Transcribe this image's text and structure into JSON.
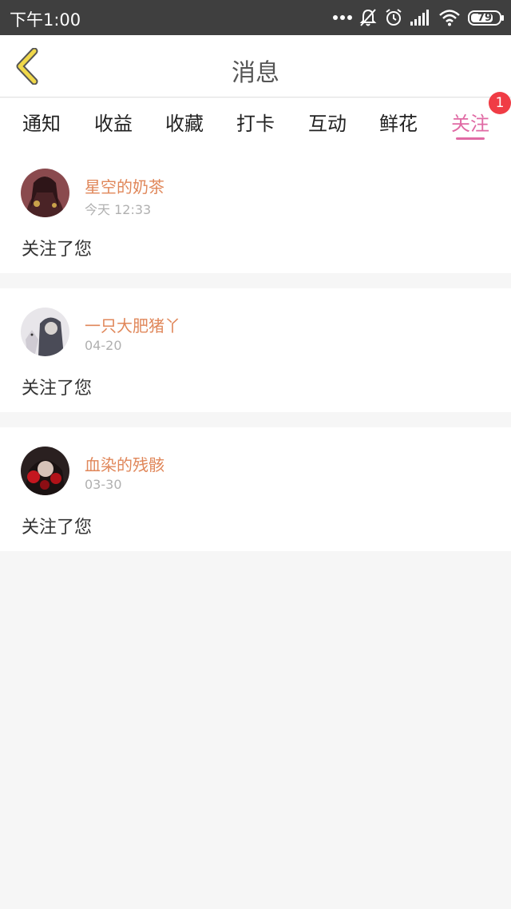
{
  "status_bar": {
    "time": "下午1:00",
    "battery": "79",
    "icons": [
      "more-dots-icon",
      "bell-muted-icon",
      "alarm-icon",
      "signal-icon",
      "wifi-icon",
      "battery-icon"
    ]
  },
  "header": {
    "title": "消息",
    "back_icon": "chevron-left-icon"
  },
  "tabs": [
    {
      "label": "通知"
    },
    {
      "label": "收益"
    },
    {
      "label": "收藏"
    },
    {
      "label": "打卡"
    },
    {
      "label": "互动"
    },
    {
      "label": "鲜花"
    },
    {
      "label": "关注",
      "active": true,
      "badge": "1"
    }
  ],
  "colors": {
    "accent": "#e06aa4",
    "username": "#e0875a",
    "badge": "#f03c45",
    "back_icon": "#f0d84a"
  },
  "feed": [
    {
      "username": "星空的奶茶",
      "time": "今天 12:33",
      "message": "关注了您"
    },
    {
      "username": "一只大肥猪丫",
      "time": "04-20",
      "message": "关注了您"
    },
    {
      "username": "血染的残骸",
      "time": "03-30",
      "message": "关注了您"
    }
  ]
}
